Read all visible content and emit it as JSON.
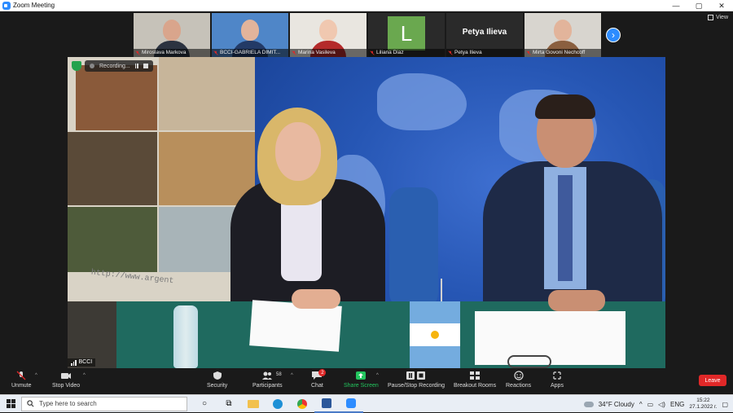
{
  "window": {
    "title": "Zoom Meeting",
    "controls": [
      "—",
      "▢",
      "✕"
    ]
  },
  "participants": [
    {
      "name": "Miroslava Markova",
      "type": "video",
      "skin": "#d9a58c",
      "clothes": "#2c3340",
      "bg": "#c6c2b9"
    },
    {
      "name": "BCCI-GABRIELA DIMIT...",
      "type": "video",
      "skin": "#e2b49b",
      "clothes": "#233a66",
      "bg": "#4f86c8"
    },
    {
      "name": "Marina Vasileva",
      "type": "video",
      "skin": "#f0c8b0",
      "clothes": "#b42a2a",
      "bg": "#e9e6e0"
    },
    {
      "name": "Liliana Diaz",
      "type": "initial",
      "initial": "L"
    },
    {
      "name": "Petya Ilieva",
      "type": "name-only",
      "display": "Petya Ilieva"
    },
    {
      "name": "Mirta Govoni Nechcoff",
      "type": "video",
      "skin": "#e2b49b",
      "clothes": "#8a5f3f",
      "bg": "#d8d5cf"
    }
  ],
  "view_label": "View",
  "recording": {
    "label": "Recording...",
    "pause_icon": "pause-icon",
    "stop_icon": "stop-icon"
  },
  "active_speaker": {
    "name": "BCCI"
  },
  "banner_url": "http://www.argent",
  "toolbar": {
    "unmute": "Unmute",
    "stop_video": "Stop Video",
    "security": "Security",
    "participants": "Participants",
    "participants_count": "58",
    "chat": "Chat",
    "chat_badge": "2",
    "share_screen": "Share Screen",
    "pause_stop_recording": "Pause/Stop Recording",
    "breakout_rooms": "Breakout Rooms",
    "reactions": "Reactions",
    "apps": "Apps",
    "leave": "Leave"
  },
  "taskbar": {
    "search_placeholder": "Type here to search",
    "weather": "34°F  Cloudy",
    "language": "ENG",
    "time": "15:22",
    "date": "27.1.2022 г."
  },
  "colors": {
    "zoom_blue": "#2d8cff",
    "leave_red": "#e02828",
    "share_green": "#23c55e",
    "initial_green": "#6aa84f"
  }
}
